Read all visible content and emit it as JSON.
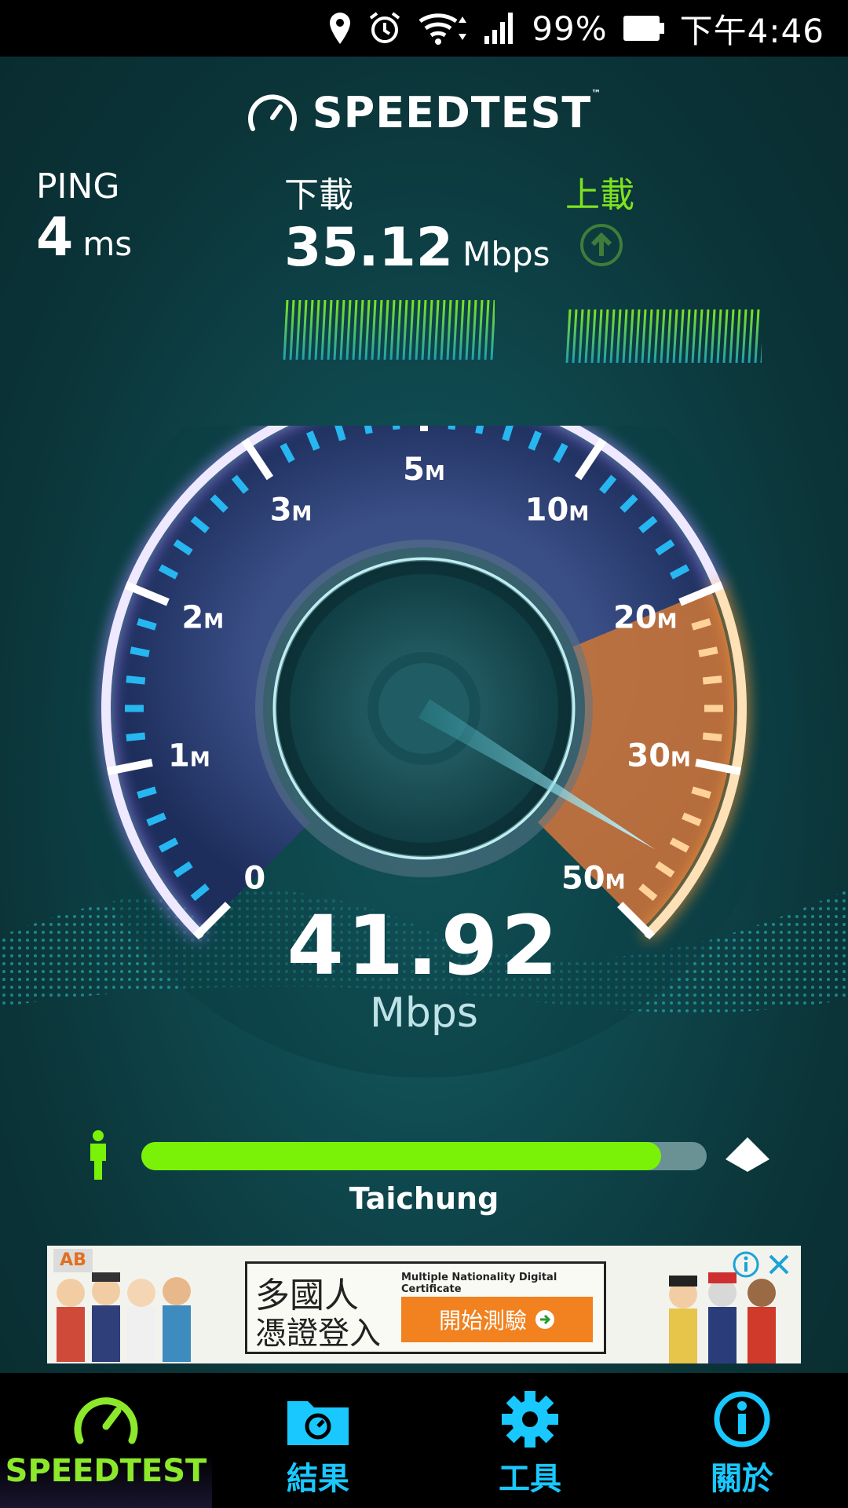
{
  "status_bar": {
    "battery": "99%",
    "time": "下午4:46",
    "icons": [
      "location-icon",
      "alarm-icon",
      "wifi-icon",
      "signal-icon",
      "battery-icon"
    ]
  },
  "header": {
    "logo_text": "SPEEDTEST",
    "trademark": "™"
  },
  "metrics": {
    "ping": {
      "label": "PING",
      "value": "4",
      "unit": "ms"
    },
    "download": {
      "label": "下載",
      "value": "35.12",
      "unit": "Mbps"
    },
    "upload": {
      "label": "上載"
    }
  },
  "gauge": {
    "scale_labels": [
      {
        "num": "0",
        "suffix": ""
      },
      {
        "num": "1",
        "suffix": "M"
      },
      {
        "num": "2",
        "suffix": "M"
      },
      {
        "num": "3",
        "suffix": "M"
      },
      {
        "num": "5",
        "suffix": "M"
      },
      {
        "num": "10",
        "suffix": "M"
      },
      {
        "num": "20",
        "suffix": "M"
      },
      {
        "num": "30",
        "suffix": "M"
      },
      {
        "num": "50",
        "suffix": "M"
      }
    ],
    "current_value": "41.92",
    "unit": "Mbps"
  },
  "progress": {
    "fraction": 0.92,
    "server": "Taichung"
  },
  "ad": {
    "title_line1": "多國人",
    "title_line2": "憑證登入",
    "subtitle": "Multiple Nationality Digital Certificate",
    "cta": "開始測驗",
    "badge": "AB"
  },
  "nav": {
    "items": [
      {
        "label": "SPEEDTEST",
        "icon": "speedometer-icon",
        "active": true
      },
      {
        "label": "結果",
        "icon": "folder-icon",
        "active": false
      },
      {
        "label": "工具",
        "icon": "gear-icon",
        "active": false
      },
      {
        "label": "關於",
        "icon": "info-icon",
        "active": false
      }
    ]
  },
  "colors": {
    "accent_green": "#79f208",
    "nav_blue": "#19c8ff",
    "gauge_orange": "#f39a3c"
  }
}
